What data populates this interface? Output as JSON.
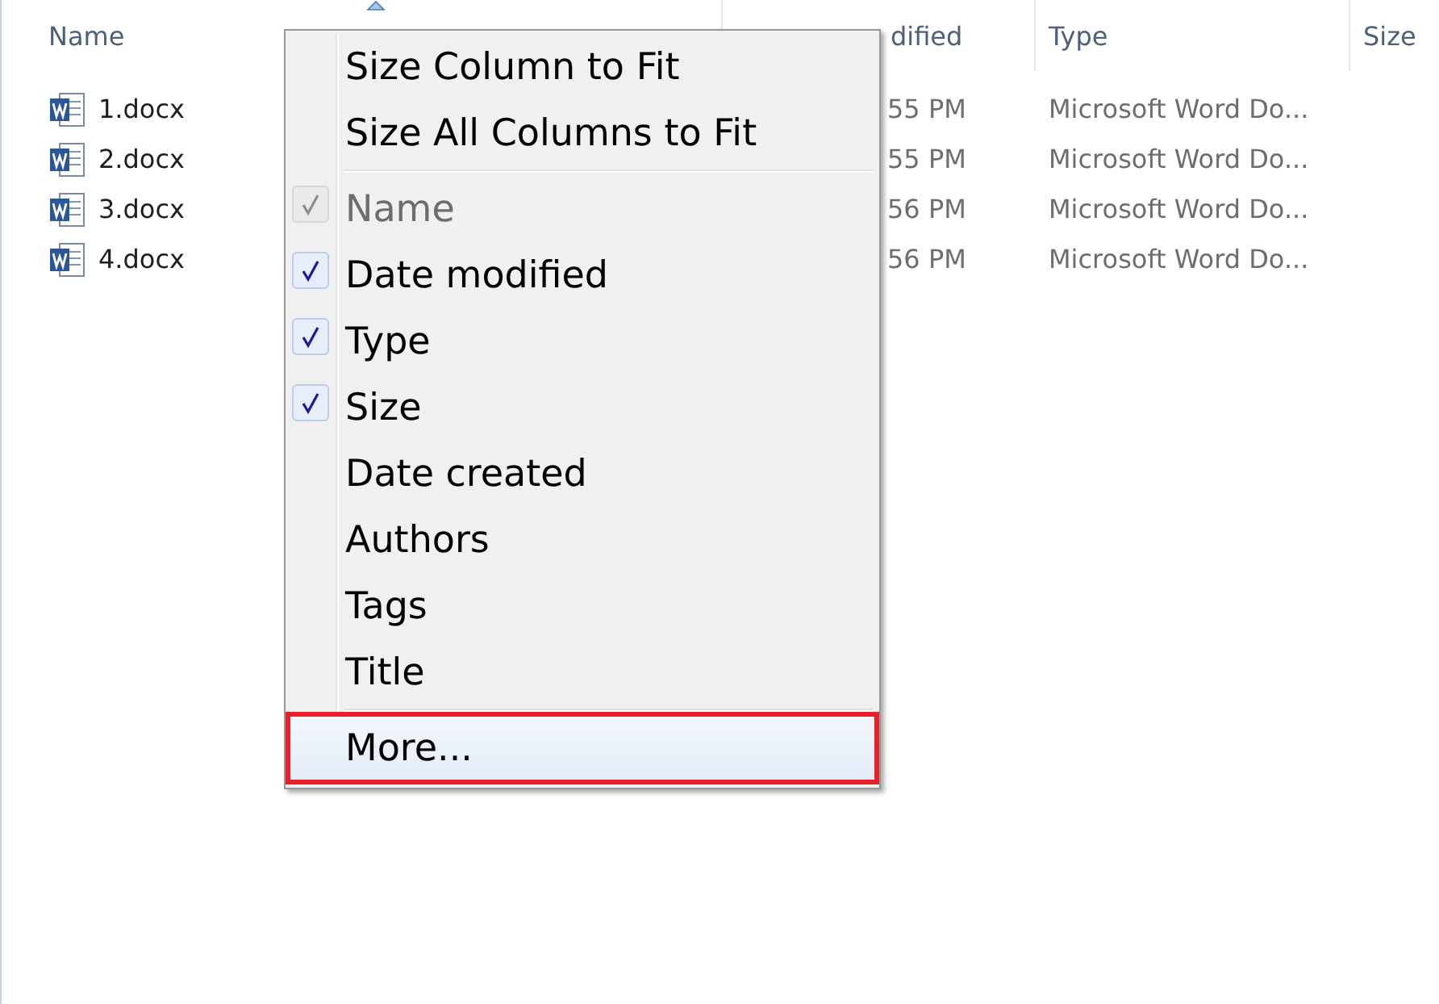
{
  "columns": [
    {
      "label": "Name",
      "sorted": true
    },
    {
      "label": "dified",
      "sorted": false
    },
    {
      "label": "Type",
      "sorted": false
    },
    {
      "label": "Size",
      "sorted": false
    }
  ],
  "files": [
    {
      "name": "1.docx",
      "date": "55 PM",
      "type": "Microsoft Word Do..."
    },
    {
      "name": "2.docx",
      "date": "55 PM",
      "type": "Microsoft Word Do..."
    },
    {
      "name": "3.docx",
      "date": "56 PM",
      "type": "Microsoft Word Do..."
    },
    {
      "name": "4.docx",
      "date": "56 PM",
      "type": "Microsoft Word Do..."
    }
  ],
  "menu": [
    {
      "kind": "action",
      "label": "Size Column to Fit"
    },
    {
      "kind": "action",
      "label": "Size All Columns to Fit"
    },
    {
      "kind": "separator"
    },
    {
      "kind": "check",
      "label": "Name",
      "checked": true,
      "disabled": true
    },
    {
      "kind": "check",
      "label": "Date modified",
      "checked": true,
      "disabled": false
    },
    {
      "kind": "check",
      "label": "Type",
      "checked": true,
      "disabled": false
    },
    {
      "kind": "check",
      "label": "Size",
      "checked": true,
      "disabled": false
    },
    {
      "kind": "check",
      "label": "Date created",
      "checked": false,
      "disabled": false
    },
    {
      "kind": "check",
      "label": "Authors",
      "checked": false,
      "disabled": false
    },
    {
      "kind": "check",
      "label": "Tags",
      "checked": false,
      "disabled": false
    },
    {
      "kind": "check",
      "label": "Title",
      "checked": false,
      "disabled": false
    },
    {
      "kind": "separator"
    },
    {
      "kind": "action",
      "label": "More...",
      "highlighted": true
    }
  ]
}
